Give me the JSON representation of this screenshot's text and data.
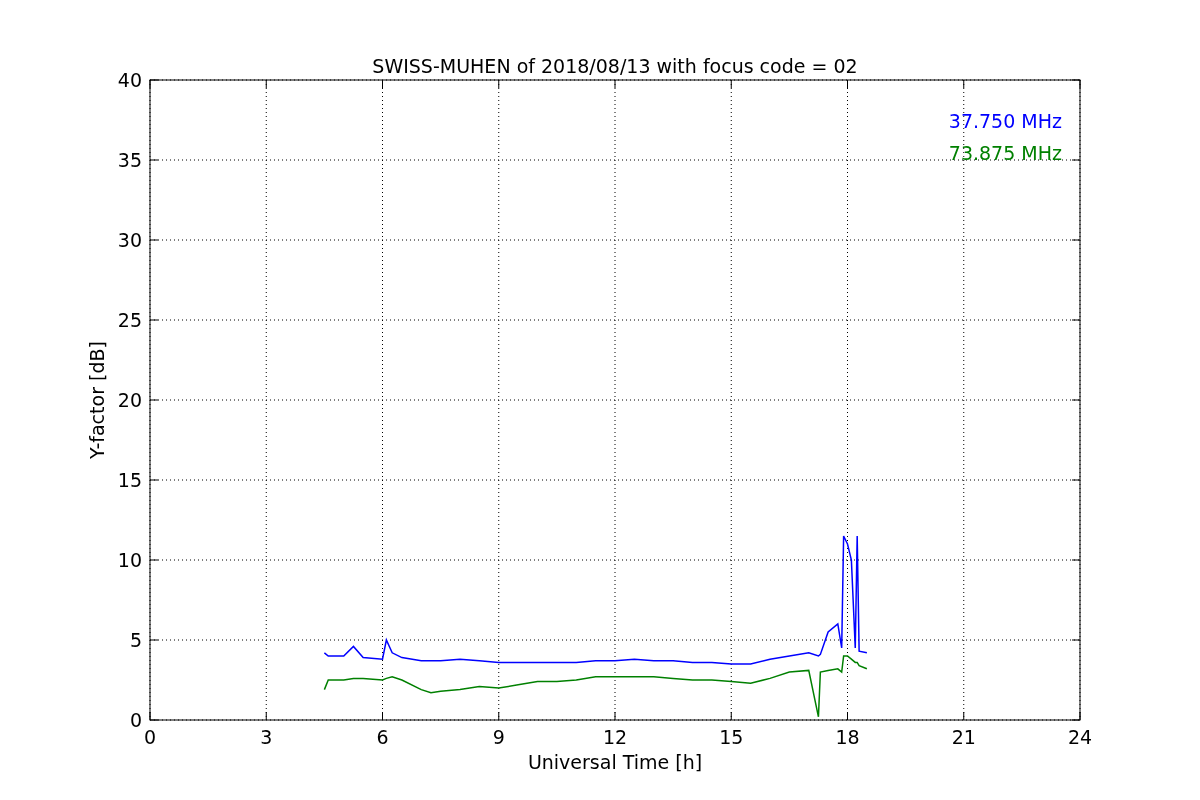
{
  "chart_data": {
    "type": "line",
    "title": "SWISS-MUHEN of 2018/08/13 with focus code = 02",
    "xlabel": "Universal Time [h]",
    "ylabel": "Y-factor [dB]",
    "x": [
      4.5,
      4.6,
      5,
      5.25,
      5.5,
      6,
      6.1,
      6.25,
      6.5,
      7,
      7.25,
      7.5,
      8,
      8.5,
      9,
      9.5,
      10,
      10.5,
      11,
      11.5,
      12,
      12.5,
      13,
      13.5,
      14,
      14.5,
      15,
      15.5,
      16,
      16.5,
      17,
      17.25,
      17.3,
      17.5,
      17.75,
      17.85,
      17.9,
      18,
      18.1,
      18.2,
      18.25,
      18.3,
      18.5
    ],
    "series": [
      {
        "name": "37.750 MHz",
        "color": "#0000ff",
        "values": [
          4.2,
          4.0,
          4.0,
          4.6,
          3.9,
          3.8,
          5.0,
          4.2,
          3.9,
          3.7,
          3.7,
          3.7,
          3.8,
          3.7,
          3.6,
          3.6,
          3.6,
          3.6,
          3.6,
          3.7,
          3.7,
          3.8,
          3.7,
          3.7,
          3.6,
          3.6,
          3.5,
          3.5,
          3.8,
          4.0,
          4.2,
          4.0,
          4.1,
          5.5,
          6.0,
          4.5,
          11.5,
          11,
          10,
          4.5,
          11.5,
          4.3,
          4.2
        ]
      },
      {
        "name": "73.875 MHz",
        "color": "#008000",
        "values": [
          1.9,
          2.5,
          2.5,
          2.6,
          2.6,
          2.5,
          2.6,
          2.7,
          2.5,
          1.9,
          1.7,
          1.8,
          1.9,
          2.1,
          2.0,
          2.2,
          2.4,
          2.4,
          2.5,
          2.7,
          2.7,
          2.7,
          2.7,
          2.6,
          2.5,
          2.5,
          2.4,
          2.3,
          2.6,
          3.0,
          3.1,
          0.2,
          3.0,
          3.1,
          3.2,
          3.0,
          4.0,
          4.0,
          3.8,
          3.6,
          3.6,
          3.4,
          3.2
        ]
      }
    ],
    "xlim": [
      0,
      24
    ],
    "ylim": [
      0,
      40
    ],
    "xticks": [
      0,
      3,
      6,
      9,
      12,
      15,
      18,
      21,
      24
    ],
    "yticks": [
      0,
      5,
      10,
      15,
      20,
      25,
      30,
      35,
      40
    ],
    "grid": true
  }
}
